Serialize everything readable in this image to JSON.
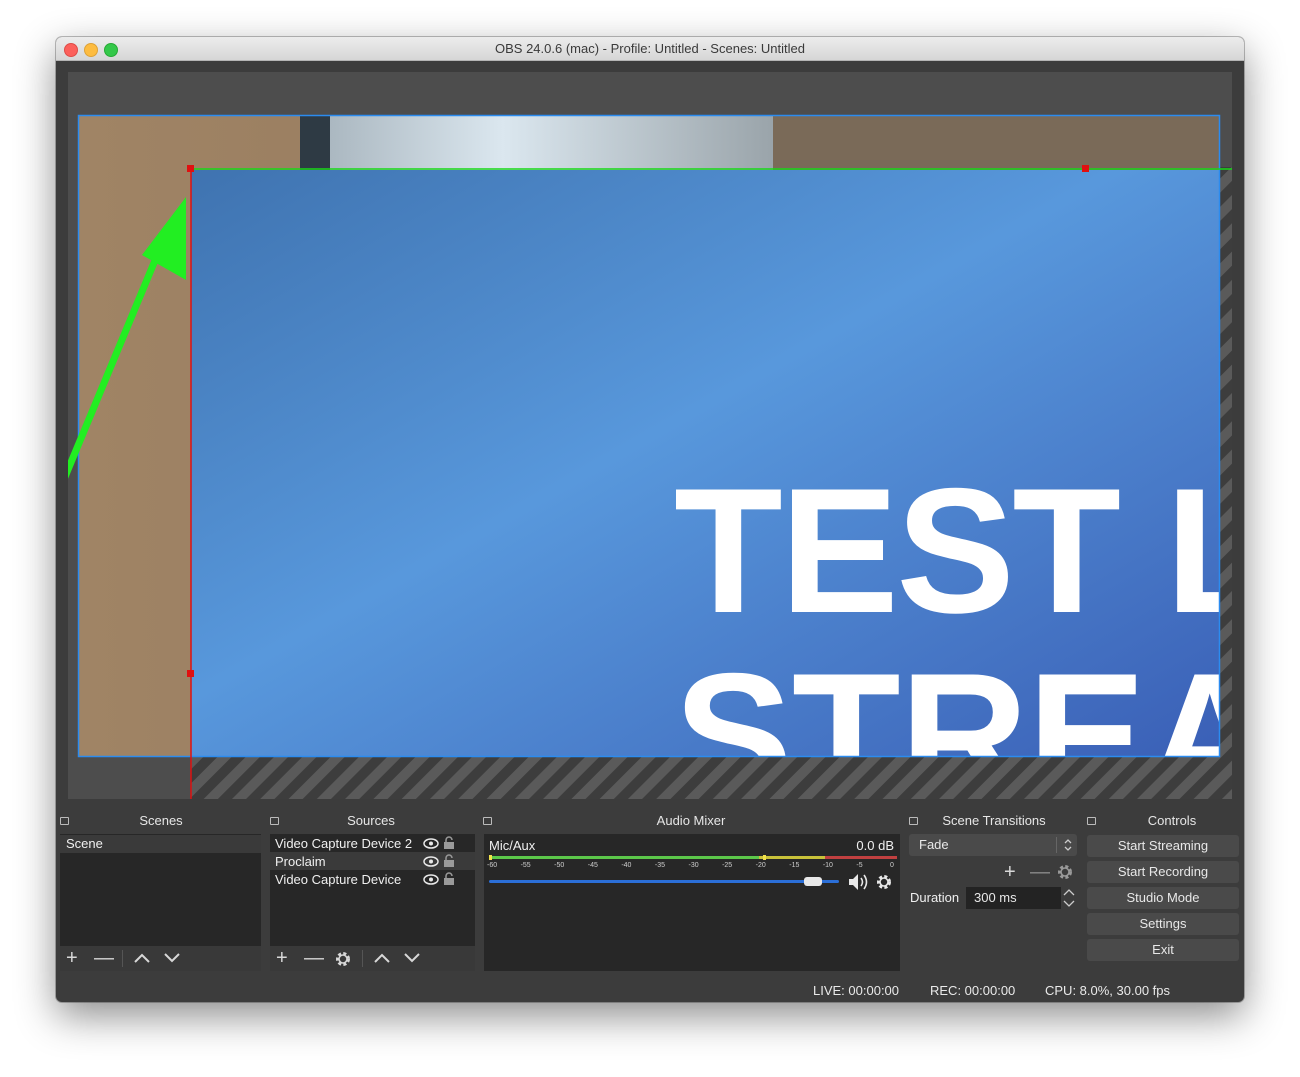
{
  "window": {
    "title": "OBS 24.0.6 (mac) - Profile: Untitled - Scenes: Untitled"
  },
  "preview": {
    "overlay_text_line1": "TEST L",
    "overlay_text_line2": "STREA"
  },
  "docks": {
    "scenes": {
      "title": "Scenes",
      "items": [
        "Scene"
      ]
    },
    "sources": {
      "title": "Sources",
      "items": [
        "Video Capture Device 2",
        "Proclaim",
        "Video Capture Device"
      ]
    },
    "audio_mixer": {
      "title": "Audio Mixer",
      "channel": "Mic/Aux",
      "level": "0.0 dB",
      "volume_fraction": 0.95,
      "scale": [
        "-60",
        "-55",
        "-50",
        "-45",
        "-40",
        "-35",
        "-30",
        "-25",
        "-20",
        "-15",
        "-10",
        "-5",
        "0"
      ]
    },
    "scene_transitions": {
      "title": "Scene Transitions",
      "selected": "Fade",
      "duration_label": "Duration",
      "duration_value": "300 ms"
    },
    "controls": {
      "title": "Controls",
      "buttons": [
        "Start Streaming",
        "Start Recording",
        "Studio Mode",
        "Settings",
        "Exit"
      ]
    }
  },
  "status": {
    "live": "LIVE: 00:00:00",
    "rec": "REC: 00:00:00",
    "cpu": "CPU: 8.0%, 30.00 fps"
  },
  "colors": {
    "window_bg": "#3c3c3c",
    "panel_bg": "#272727",
    "accent_blue": "#2b8cf0",
    "selection_red": "#e01010",
    "selection_green": "#18d818",
    "arrow_green": "#22ee22"
  }
}
